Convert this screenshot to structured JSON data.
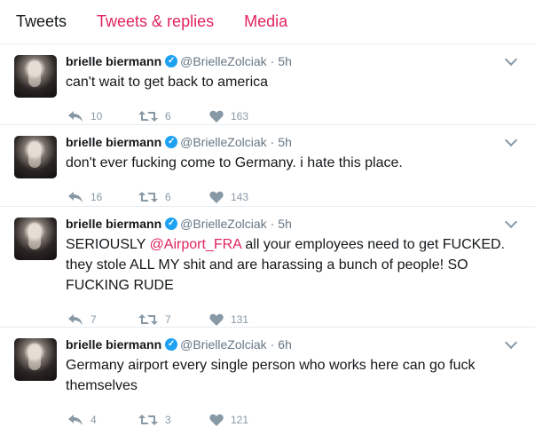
{
  "tabs": [
    {
      "label": "Tweets",
      "active": true
    },
    {
      "label": "Tweets & replies",
      "active": false
    },
    {
      "label": "Media",
      "active": false
    }
  ],
  "colors": {
    "accent": "#e0245e",
    "verified": "#1da1f2",
    "muted": "#657786"
  },
  "tweets": [
    {
      "name": "brielle biermann",
      "handle": "@BrielleZolciak",
      "sep": "·",
      "time": "5h",
      "text_parts": {
        "before": "can't wait to get back to america",
        "mention": "",
        "after": ""
      },
      "replies": "10",
      "retweets": "6",
      "likes": "163"
    },
    {
      "name": "brielle biermann",
      "handle": "@BrielleZolciak",
      "sep": "·",
      "time": "5h",
      "text_parts": {
        "before": "don't ever fucking come to Germany. i hate this place.",
        "mention": "",
        "after": ""
      },
      "replies": "16",
      "retweets": "6",
      "likes": "143"
    },
    {
      "name": "brielle biermann",
      "handle": "@BrielleZolciak",
      "sep": "·",
      "time": "5h",
      "text_parts": {
        "before": "SERIOUSLY ",
        "mention": "@Airport_FRA",
        "after": " all your employees need to get FUCKED. they stole ALL MY shit and are harassing a bunch of people! SO FUCKING RUDE"
      },
      "replies": "7",
      "retweets": "7",
      "likes": "131"
    },
    {
      "name": "brielle biermann",
      "handle": "@BrielleZolciak",
      "sep": "·",
      "time": "6h",
      "text_parts": {
        "before": "Germany airport every single person who works here can go fuck themselves",
        "mention": "",
        "after": ""
      },
      "replies": "4",
      "retweets": "3",
      "likes": "121"
    }
  ]
}
